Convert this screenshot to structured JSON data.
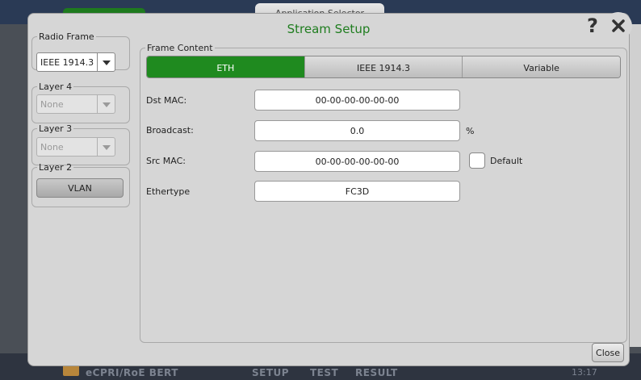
{
  "background": {
    "app_selector_label": "Application Selector",
    "bottom_items": [
      "eCPRI/RoE BERT",
      "SETUP",
      "TEST",
      "RESULT"
    ],
    "time": "13:17"
  },
  "dialog": {
    "title": "Stream Setup",
    "help_label": "?",
    "close_label": "Close"
  },
  "left_panel": {
    "radio_frame": {
      "legend": "Radio Frame",
      "value": "IEEE 1914.3"
    },
    "layer4": {
      "legend": "Layer 4",
      "value": "None"
    },
    "layer3": {
      "legend": "Layer 3",
      "value": "None"
    },
    "layer2": {
      "legend": "Layer 2",
      "button": "VLAN"
    }
  },
  "frame_content": {
    "legend": "Frame Content",
    "tabs": [
      {
        "label": "ETH",
        "active": true
      },
      {
        "label": "IEEE 1914.3",
        "active": false
      },
      {
        "label": "Variable",
        "active": false
      }
    ],
    "fields": {
      "dst_mac": {
        "label": "Dst MAC:",
        "value": "00-00-00-00-00-00"
      },
      "broadcast": {
        "label": "Broadcast:",
        "value": "0.0",
        "unit": "%"
      },
      "src_mac": {
        "label": "Src MAC:",
        "value": "00-00-00-00-00-00",
        "default_label": "Default",
        "default_checked": false
      },
      "ethertype": {
        "label": "Ethertype",
        "value": "FC3D"
      }
    }
  },
  "colors": {
    "accent_green": "#1f8a1f",
    "title_green": "#1f7d1f"
  },
  "icons": {
    "dropdown": "chevron-down-icon",
    "close": "close-icon",
    "help": "help-icon"
  }
}
